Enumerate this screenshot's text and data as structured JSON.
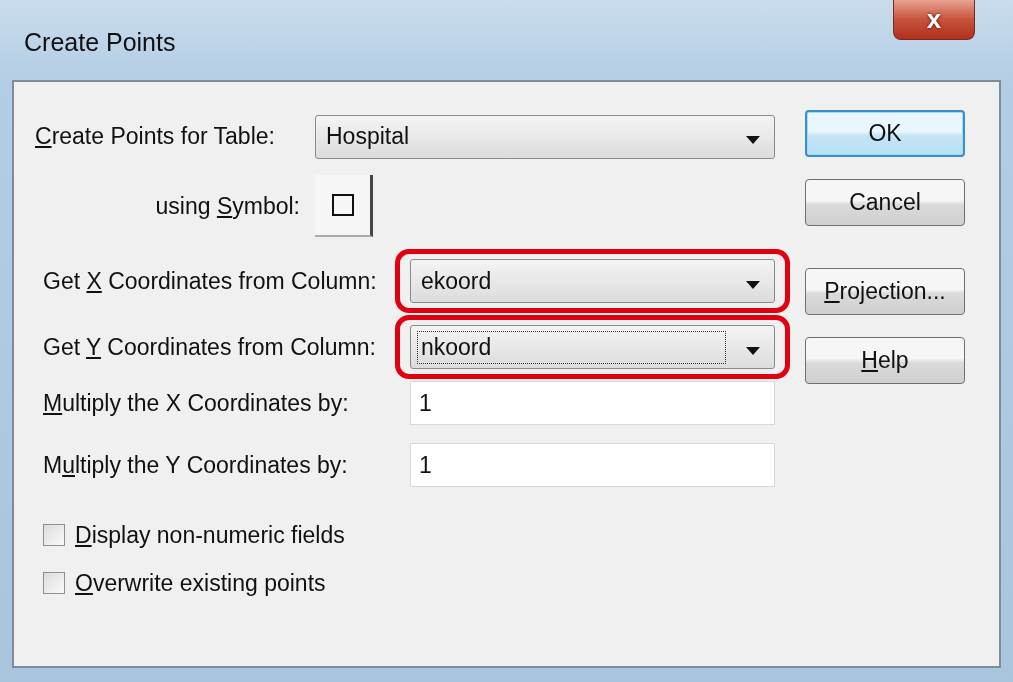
{
  "window": {
    "title": "Create Points",
    "close_label": "x"
  },
  "table_field": {
    "label": {
      "key": "C",
      "post": "reate Points for Table:"
    },
    "value": "Hospital"
  },
  "symbol_field": {
    "label": {
      "pre": "using ",
      "key": "S",
      "post": "ymbol:"
    }
  },
  "column_fields": [
    {
      "label": {
        "pre": "Get ",
        "key": "X",
        "post": " Coordinates from Column:"
      },
      "value": "ekoord",
      "highlighted": true,
      "focused": false
    },
    {
      "label": {
        "pre": "Get ",
        "key": "Y",
        "post": " Coordinates from Column:"
      },
      "value": "nkoord",
      "highlighted": true,
      "focused": true
    }
  ],
  "multiply_fields": [
    {
      "label": {
        "key": "M",
        "post": "ultiply the X Coordinates by:"
      },
      "value": "1"
    },
    {
      "label": {
        "pre": "M",
        "key": "u",
        "post": "ltiply the Y Coordinates by:"
      },
      "value": "1"
    }
  ],
  "checkboxes": [
    {
      "label": {
        "key": "D",
        "post": "isplay non-numeric fields"
      },
      "checked": false
    },
    {
      "label": {
        "key": "O",
        "post": "verwrite existing points"
      },
      "checked": false
    }
  ],
  "buttons": [
    {
      "label": {
        "pre": "OK"
      },
      "default": true
    },
    {
      "label": {
        "pre": "Cancel"
      },
      "default": false
    },
    {
      "label": {
        "key": "P",
        "post": "rojection..."
      },
      "default": false
    },
    {
      "label": {
        "key": "H",
        "post": "elp"
      },
      "default": false
    }
  ]
}
